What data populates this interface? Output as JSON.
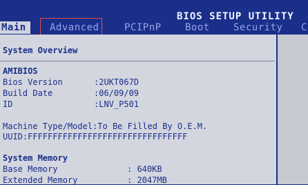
{
  "title": "BIOS SETUP UTILITY",
  "menu": {
    "tabs": [
      {
        "label": "Main",
        "active": true
      },
      {
        "label": "Advanced",
        "active": false
      },
      {
        "label": "PCIPnP",
        "active": false
      },
      {
        "label": "Boot",
        "active": false
      },
      {
        "label": "Security",
        "active": false
      },
      {
        "label": "C",
        "active": false
      }
    ]
  },
  "main": {
    "section_title": "System Overview",
    "bios_header": "AMIBIOS",
    "bios_version_label": "Bios Version",
    "bios_version_value": ":2UKT067D",
    "build_date_label": "Build Date",
    "build_date_value": ":06/09/09",
    "id_label": "ID",
    "id_value": ":LNV_P501",
    "machine_type_line": "Machine Type/Model:To Be Filled By O.E.M.",
    "uuid_line": "UUID:FFFFFFFFFFFFFFFFFFFFFFFFFFFFFFFF",
    "memory_header": "System Memory",
    "base_memory_label": "Base Memory",
    "base_memory_value": ": 640KB",
    "extended_memory_label": "Extended Memory",
    "extended_memory_value": ": 2047MB"
  },
  "colors": {
    "background": "#1a2f8a",
    "panel": "#d4d6df",
    "text": "#1a2f8a",
    "highlight_box": "#e34b4b"
  }
}
